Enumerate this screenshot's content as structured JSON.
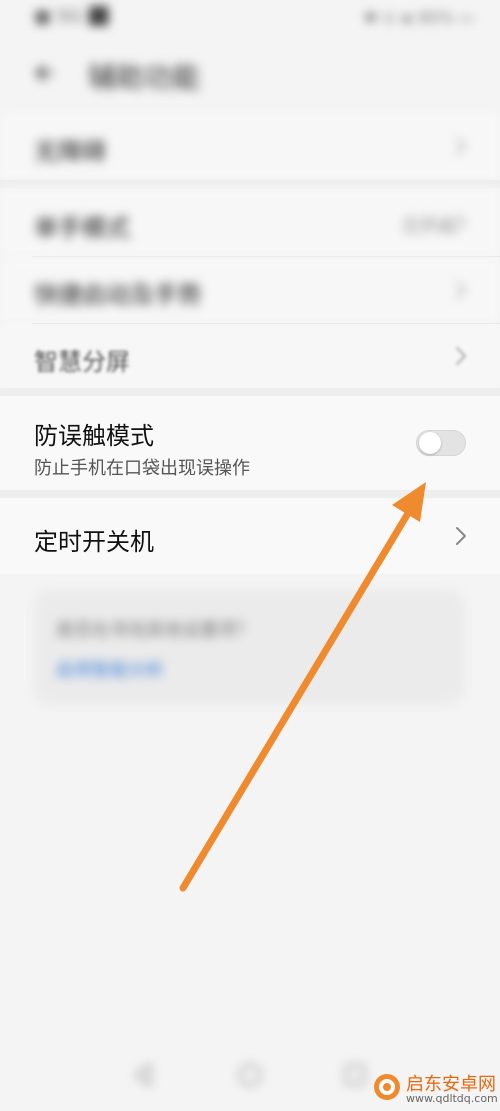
{
  "status_bar": {
    "left_text": "■ 5G ⬛",
    "right_text": "✱ ⊙ ◈ 80% ▭"
  },
  "header": {
    "title": "辅助功能",
    "back_icon": "back-arrow-icon"
  },
  "list": {
    "items": [
      {
        "label": "无障碍",
        "value": "",
        "icon": "chevron-right-icon",
        "blurred": true
      },
      {
        "label": "单手模式",
        "value": "已开启",
        "icon": "chevron-right-icon",
        "blurred": true
      },
      {
        "label": "快捷启动及手势",
        "value": "",
        "icon": "chevron-right-icon",
        "blurred": true
      },
      {
        "label": "智慧分屏",
        "value": "",
        "icon": "chevron-right-icon",
        "blurred": false
      }
    ],
    "anti_mistouch": {
      "label": "防误触模式",
      "description": "防止手机在口袋出现误操作",
      "toggle_state": "off"
    },
    "scheduled_power": {
      "label": "定时开关机",
      "icon": "chevron-right-icon"
    }
  },
  "info_card": {
    "question": "是否在寻找其他设置项？",
    "link": "启用智能分析"
  },
  "navbar": {
    "back_icon": "nav-back-icon",
    "home_icon": "nav-home-icon",
    "recents_icon": "nav-recents-icon"
  },
  "watermark": {
    "title": "启东安卓网",
    "url": "www.qdltdq.com"
  },
  "colors": {
    "accent_link": "#3f80d8",
    "arrow": "#f08a2e",
    "watermark_orange": "#e8690d"
  }
}
